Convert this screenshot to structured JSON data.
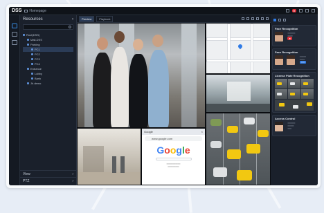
{
  "app": {
    "logo": "DSS",
    "tab_label": "Homepage"
  },
  "sidebar": {
    "title": "Resources",
    "tree": [
      {
        "label": "Root(DSS)",
        "level": 0
      },
      {
        "label": "Mall-DSS",
        "level": 1
      },
      {
        "label": "Parking",
        "level": 1
      },
      {
        "label": "PC1",
        "level": 2,
        "selected": true
      },
      {
        "label": "PC2",
        "level": 2
      },
      {
        "label": "PC3",
        "level": 2
      },
      {
        "label": "PC4",
        "level": 2
      },
      {
        "label": "Entrance",
        "level": 1
      },
      {
        "label": "Lobby",
        "level": 2
      },
      {
        "label": "Bank",
        "level": 2
      },
      {
        "label": "Jh.demo",
        "level": 1
      }
    ],
    "footer": [
      "View",
      "PTZ"
    ]
  },
  "toolbar": {
    "tabs": [
      "Preview",
      "Playback"
    ]
  },
  "browser": {
    "tab_title": "Google",
    "address": "www.google.com",
    "logo_text": "Google"
  },
  "events": {
    "cards": [
      {
        "title": "Face Recognition",
        "kind": "face"
      },
      {
        "title": "Face Recognition",
        "kind": "face-compare"
      },
      {
        "title": "License Plate Recognition",
        "kind": "plate"
      },
      {
        "title": "Access Control",
        "kind": "access"
      }
    ]
  },
  "colors": {
    "accent": "#2f7be6",
    "app_bg": "#161b24",
    "alert": "#e0303a"
  }
}
